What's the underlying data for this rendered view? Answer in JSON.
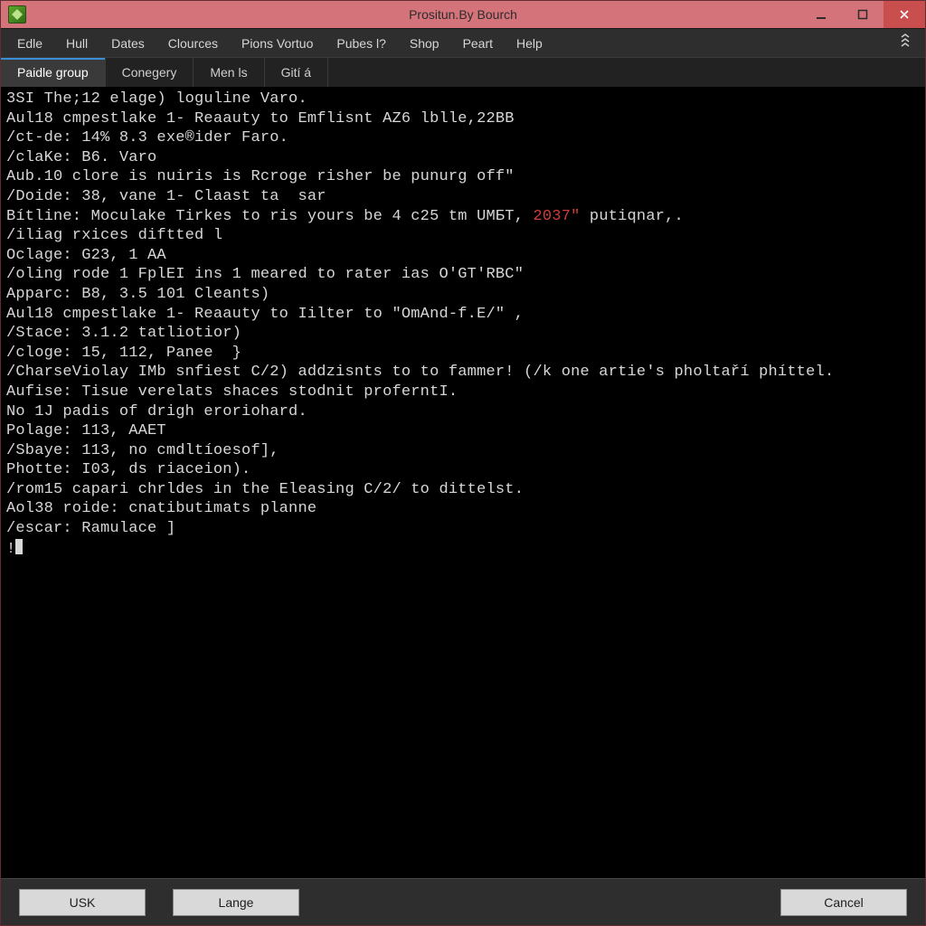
{
  "colors": {
    "titlebar_bg": "#d47379",
    "close_bg": "#c94f4f",
    "menubar_bg": "#2e2e2e",
    "tab_active_accent": "#3a8fd6",
    "terminal_bg": "#000000",
    "terminal_fg": "#d7d7d7",
    "red": "#d23b3b"
  },
  "window": {
    "title": "Prositun.By Bourch"
  },
  "menu": {
    "items": [
      "Edle",
      "Hull",
      "Dates",
      "Clources",
      "Pions Vortuo",
      "Pubes l?",
      "Shop",
      "Peart",
      "Help"
    ]
  },
  "tabs": {
    "items": [
      "Paidle group",
      "Conegery",
      "Men ls",
      "Gití á"
    ],
    "active_index": 0
  },
  "terminal": {
    "lines": [
      {
        "segments": [
          {
            "text": "3SI The;12 elage) loguline Varo."
          }
        ]
      },
      {
        "segments": [
          {
            "text": "Aul18 cmpestlake 1- Reaauty to Emflisnt AZ6 lblle,22BB"
          }
        ]
      },
      {
        "segments": [
          {
            "text": "/ct-de: 14% 8.3 exe®ider Faro."
          }
        ]
      },
      {
        "segments": [
          {
            "text": "/claKe: B6. Varo"
          }
        ]
      },
      {
        "segments": [
          {
            "text": "Aub.10 clore is nuiris is Rcroge risher be punurg off\""
          }
        ]
      },
      {
        "segments": [
          {
            "text": "/Doide: 38, vane 1- Claast ta  sar"
          }
        ]
      },
      {
        "segments": [
          {
            "text": "Bítline: Moculake Tirkes to ris yours be 4 c25 tm UMБT, "
          },
          {
            "text": "2037\"",
            "class": "red"
          },
          {
            "text": " putiqnar,."
          }
        ]
      },
      {
        "segments": [
          {
            "text": "/iliag rxices diftted l"
          }
        ]
      },
      {
        "segments": [
          {
            "text": "Oclage: G23, 1 AA"
          }
        ]
      },
      {
        "segments": [
          {
            "text": "/oling rode 1 FplEI ins 1 meared to rater ias O'GT'RBC\""
          }
        ]
      },
      {
        "segments": [
          {
            "text": "Apparc: B8, 3.5 101 Cleants)"
          }
        ]
      },
      {
        "segments": [
          {
            "text": "Aul18 cmpestlake 1- Reaauty to Iilter to \"OmAnd-f.E/\" ,"
          }
        ]
      },
      {
        "segments": [
          {
            "text": "/Stace: 3.1.2 tatliotior)"
          }
        ]
      },
      {
        "segments": [
          {
            "text": "/cloge: 15, 112, Panee  }"
          }
        ]
      },
      {
        "segments": [
          {
            "text": "/CharseViolay IMb snfiest C/2) addzisnts to to fammer! (/k one artie's pholtaří phíttel."
          }
        ]
      },
      {
        "segments": [
          {
            "text": "Aufise: Tisue verelats shaces stodnit proferntI."
          }
        ]
      },
      {
        "segments": [
          {
            "text": "No 1J padis of drigh eroriohard."
          }
        ]
      },
      {
        "segments": [
          {
            "text": "Polage: 113, AAET"
          }
        ]
      },
      {
        "segments": [
          {
            "text": "/Sbaye: 113, no cmdltíoesof],"
          }
        ]
      },
      {
        "segments": [
          {
            "text": "Photte: I03, ds riaceion)."
          }
        ]
      },
      {
        "segments": [
          {
            "text": "/rom15 capari chrldes in the Eleasing C/2/ to dittelst."
          }
        ]
      },
      {
        "segments": [
          {
            "text": "Aol38 roide: cnatibutimats planne"
          }
        ]
      },
      {
        "segments": [
          {
            "text": "/escar: Ramulace ]"
          }
        ]
      }
    ],
    "prompt": "!"
  },
  "footer": {
    "buttons": {
      "usk": "USK",
      "lange": "Lange",
      "cancel": "Cancel"
    }
  }
}
